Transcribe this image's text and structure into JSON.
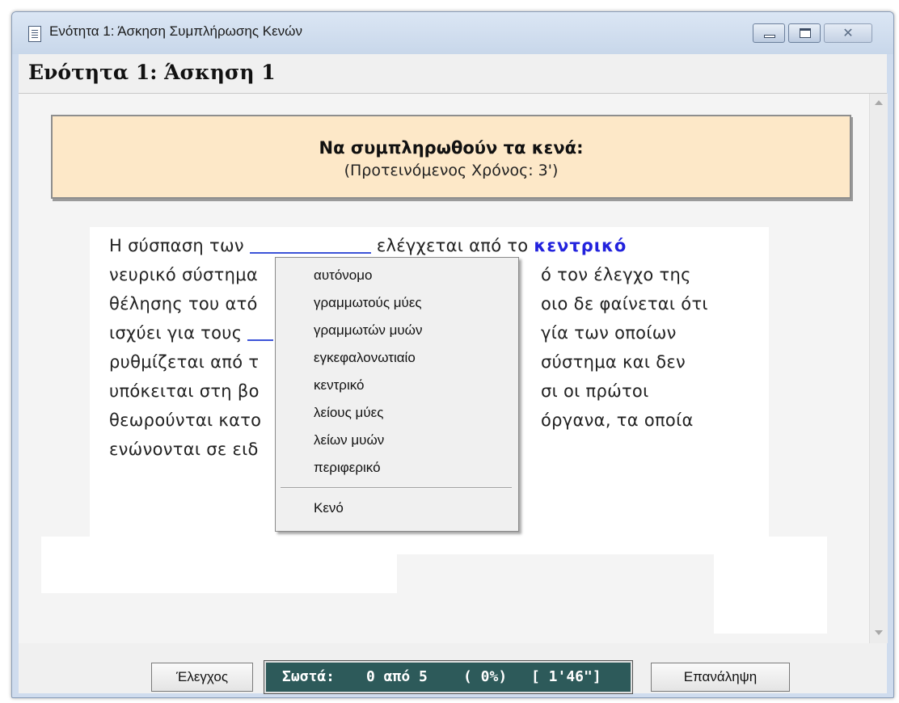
{
  "window": {
    "title": "Ενότητα 1: Άσκηση Συμπλήρωσης Κενών",
    "close_glyph": "✕"
  },
  "heading": "Ενότητα 1: Άσκηση 1",
  "instructions": {
    "title": "Να συμπληρωθούν τα κενά:",
    "subtitle": "(Προτεινόμενος Χρόνος: 3')"
  },
  "text": {
    "l1_a": "Η σύσπαση των ",
    "l1_b": " ελέγχεται από το ",
    "l1_filled": "κεντρικό",
    "l2_a": "νευρικό σύστημα",
    "l2_b": "ό τον έλεγχο της",
    "l3_a": "θέλησης του ατό",
    "l3_b": "οιο δε φαίνεται ότι",
    "l4_a": "ισχύει για τους ",
    "l4_b": "γία των οποίων",
    "l5_a": "ρυθμίζεται από τ",
    "l5_b": "σύστημα και δεν",
    "l6_a": "υπόκειται στη βο",
    "l6_b": "σι οι πρώτοι",
    "l7_a": "θεωρούνται κατο",
    "l7_b": "όργανα, τα οποία",
    "l8_a": "ενώνονται σε ειδ"
  },
  "menu": {
    "items": [
      "αυτόνομο",
      "γραμμωτούς μύες",
      "γραμμωτών μυών",
      "εγκεφαλονωτιαίο",
      "κεντρικό",
      "λείους μύες",
      "λείων μυών",
      "περιφερικό"
    ],
    "empty": "Κενό"
  },
  "buttons": {
    "check": "Έλεγχος",
    "repeat": "Επανάληψη"
  },
  "status": {
    "label": "Σωστά:",
    "count": "0 από 5",
    "percent": "( 0%)",
    "time": "[ 1'46\"]"
  }
}
